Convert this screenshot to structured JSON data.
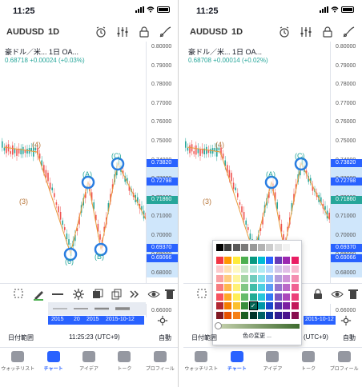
{
  "status": {
    "time": "11:25"
  },
  "toolbar": {
    "symbol": "AUDUSD",
    "interval": "1D"
  },
  "legend": {
    "title": "豪ドル／米... 1日 OA...",
    "change_left": "0.68718 +0.00024 (+0.03%)",
    "change_right": "0.68708 +0.00014 (+0.02%)"
  },
  "price_ticks": [
    "0.80000",
    "0.79000",
    "0.78000",
    "0.77000",
    "0.76000",
    "0.75000",
    "0.74000",
    "0.73000",
    "0.72000",
    "0.71000",
    "0.70000",
    "0.69000",
    "0.68000",
    "0.67000",
    "0.66000"
  ],
  "price_tags": [
    {
      "text": "0.73820",
      "color": "#2962ff"
    },
    {
      "text": "0.72798",
      "color": "#2962ff"
    },
    {
      "text": "0.71860",
      "color": "#26a69a"
    },
    {
      "text": "0.69370",
      "color": "#2962ff"
    },
    {
      "text": "0.69066",
      "color": "#2962ff"
    }
  ],
  "wave_labels": [
    "(4)",
    "(3)",
    "(A)",
    "(B)",
    "(C)",
    "(6)"
  ],
  "date_strip": [
    "2015",
    "20",
    "2015",
    "2015-10-12"
  ],
  "date_strip_right": "2015-10-12",
  "footer": {
    "range": "日付範囲",
    "clock": "11:25:23 (UTC+9)",
    "auto": "自動"
  },
  "tabs": [
    {
      "label": "ウォッチリスト",
      "icon": "list-icon"
    },
    {
      "label": "チャート",
      "icon": "chart-icon"
    },
    {
      "label": "アイデア",
      "icon": "bulb-icon"
    },
    {
      "label": "トーク",
      "icon": "chat-icon"
    },
    {
      "label": "プロフィール",
      "icon": "profile-icon"
    }
  ],
  "popup": {
    "change_color": "色の変更 ..."
  },
  "colors": {
    "up": "#26a69a",
    "down": "#ef5350",
    "accent": "#2962ff",
    "wave": "#b8763a"
  }
}
